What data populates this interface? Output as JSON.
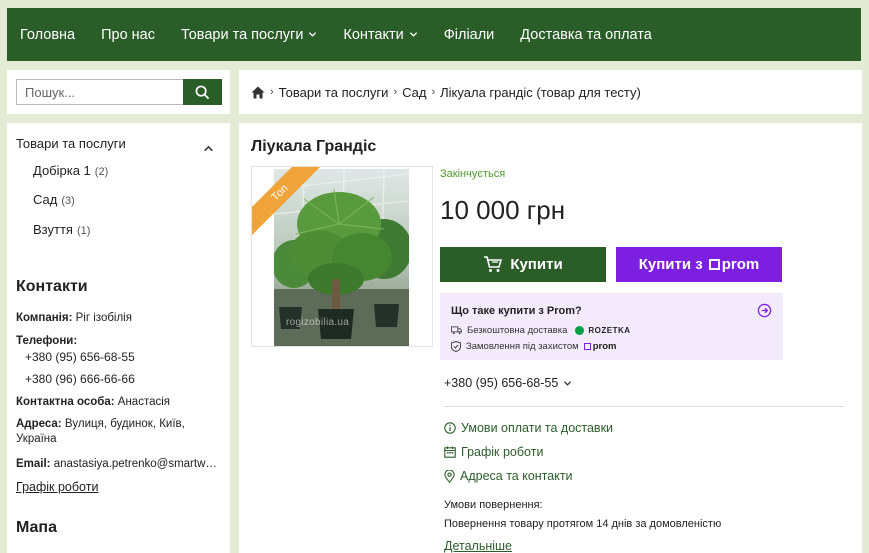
{
  "nav": {
    "items": [
      {
        "label": "Головна",
        "dropdown": false
      },
      {
        "label": "Про нас",
        "dropdown": false
      },
      {
        "label": "Товари та послуги",
        "dropdown": true
      },
      {
        "label": "Контакти",
        "dropdown": true
      },
      {
        "label": "Філіали",
        "dropdown": false
      },
      {
        "label": "Доставка та оплата",
        "dropdown": false
      }
    ]
  },
  "search": {
    "placeholder": "Пошук...",
    "icon": "search-icon"
  },
  "breadcrumb": {
    "home_icon": "home-icon",
    "items": [
      "Товари та послуги",
      "Сад",
      "Лікуала грандіс (товар для тесту)"
    ]
  },
  "sidebar": {
    "categories_title": "Товари та послуги",
    "categories": [
      {
        "label": "Добірка 1",
        "count": "(2)"
      },
      {
        "label": "Сад",
        "count": "(3)"
      },
      {
        "label": "Взуття",
        "count": "(1)"
      }
    ],
    "contacts_title": "Контакти",
    "company_label": "Компанія:",
    "company_value": "Ріг ізобілія",
    "phones_label": "Телефони:",
    "phones": [
      "+380 (95) 656-68-55",
      "+380 (96) 666-66-66"
    ],
    "person_label": "Контактна особа:",
    "person_value": "Анастасія",
    "address_label": "Адреса:",
    "address_value": "Вулиця, будинок, Київ, Україна",
    "email_label": "Email:",
    "email_value": "anastasiya.petrenko@smartweb.com.ua",
    "schedule_link": "Графік роботи",
    "map_title": "Мапа"
  },
  "product": {
    "title": "Ліукала Грандіс",
    "badge": "Топ",
    "watermark": "rogizobilia.ua",
    "stock_status": "Закінчується",
    "price": "10 000 грн",
    "buy_label": "Купити",
    "prom_buy_label": "Купити з",
    "prom_brand": "prom",
    "prom_info": {
      "title": "Що таке купити з Prom?",
      "delivery_text": "Безкоштовна доставка",
      "rozetka": "ROZETKA",
      "protection_text": "Замовлення під захистом",
      "prom": "prom"
    },
    "phone": "+380 (95) 656-68-55",
    "links": [
      "Умови оплати та доставки",
      "Графік роботи",
      "Адреса та контакти"
    ],
    "return_title": "Умови повернення:",
    "return_text": "Повернення товару протягом 14 днів за домовленістю",
    "more_link": "Детальніше"
  },
  "colors": {
    "primary": "#2b5d29",
    "prom": "#7c1fe0",
    "badge": "#f0a338",
    "background": "#e3ebd5"
  }
}
